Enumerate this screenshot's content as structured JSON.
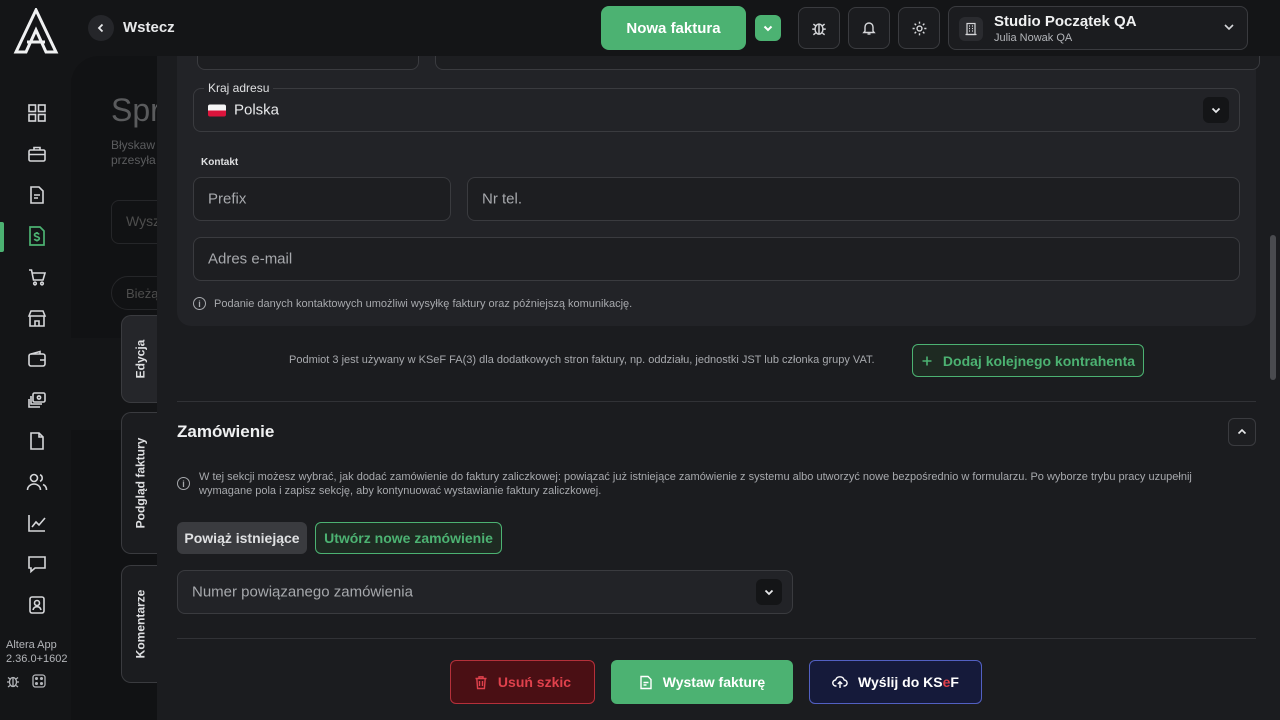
{
  "app": {
    "version_name": "Altera App",
    "version_number": "2.36.0+1602"
  },
  "topbar": {
    "back_label": "Wstecz",
    "new_invoice_label": "Nowa faktura",
    "org_name": "Studio Początek QA",
    "org_user": "Julia Nowak QA"
  },
  "background": {
    "title": "Spr",
    "subtitle_line1": "Błyskaw",
    "subtitle_line2": "przesyła",
    "search_placeholder": "Wysz",
    "chip_label": "Bieżą"
  },
  "side_tabs": {
    "edit": "Edycja",
    "preview": "Podgląd faktury",
    "comments": "Komentarze"
  },
  "address": {
    "country_legend": "Kraj adresu",
    "country_value": "Polska"
  },
  "contact": {
    "section_label": "Kontakt",
    "prefix_placeholder": "Prefix",
    "phone_placeholder": "Nr tel.",
    "email_placeholder": "Adres e-mail",
    "hint": "Podanie danych kontaktowych umożliwi wysyłkę faktury oraz późniejszą komunikację."
  },
  "third_party": {
    "note": "Podmiot 3 jest używany w KSeF FA(3) dla dodatkowych stron faktury, np. oddziału, jednostki JST lub członka grupy VAT.",
    "add_button": "Dodaj kolejnego kontrahenta"
  },
  "order": {
    "title": "Zamówienie",
    "hint": "W tej sekcji możesz wybrać, jak dodać zamówienie do faktury zaliczkowej: powiązać już istniejące zamówienie z systemu albo utworzyć nowe bezpośrednio w formularzu. Po wyborze trybu pracy uzupełnij wymagane pola i zapisz sekcję, aby kontynuować wystawianie faktury zaliczkowej.",
    "link_existing": "Powiąż istniejące",
    "create_new": "Utwórz nowe zamówienie",
    "select_placeholder": "Numer powiązanego zamówienia"
  },
  "actions": {
    "delete_draft": "Usuń szkic",
    "issue_invoice": "Wystaw fakturę",
    "send_ksef_prefix": "Wyślij do KS",
    "send_ksef_e": "e",
    "send_ksef_suffix": "F"
  },
  "colors": {
    "accent_green": "#4cb272",
    "danger_red": "#e0414c",
    "ksef_blue": "#5260c2"
  }
}
